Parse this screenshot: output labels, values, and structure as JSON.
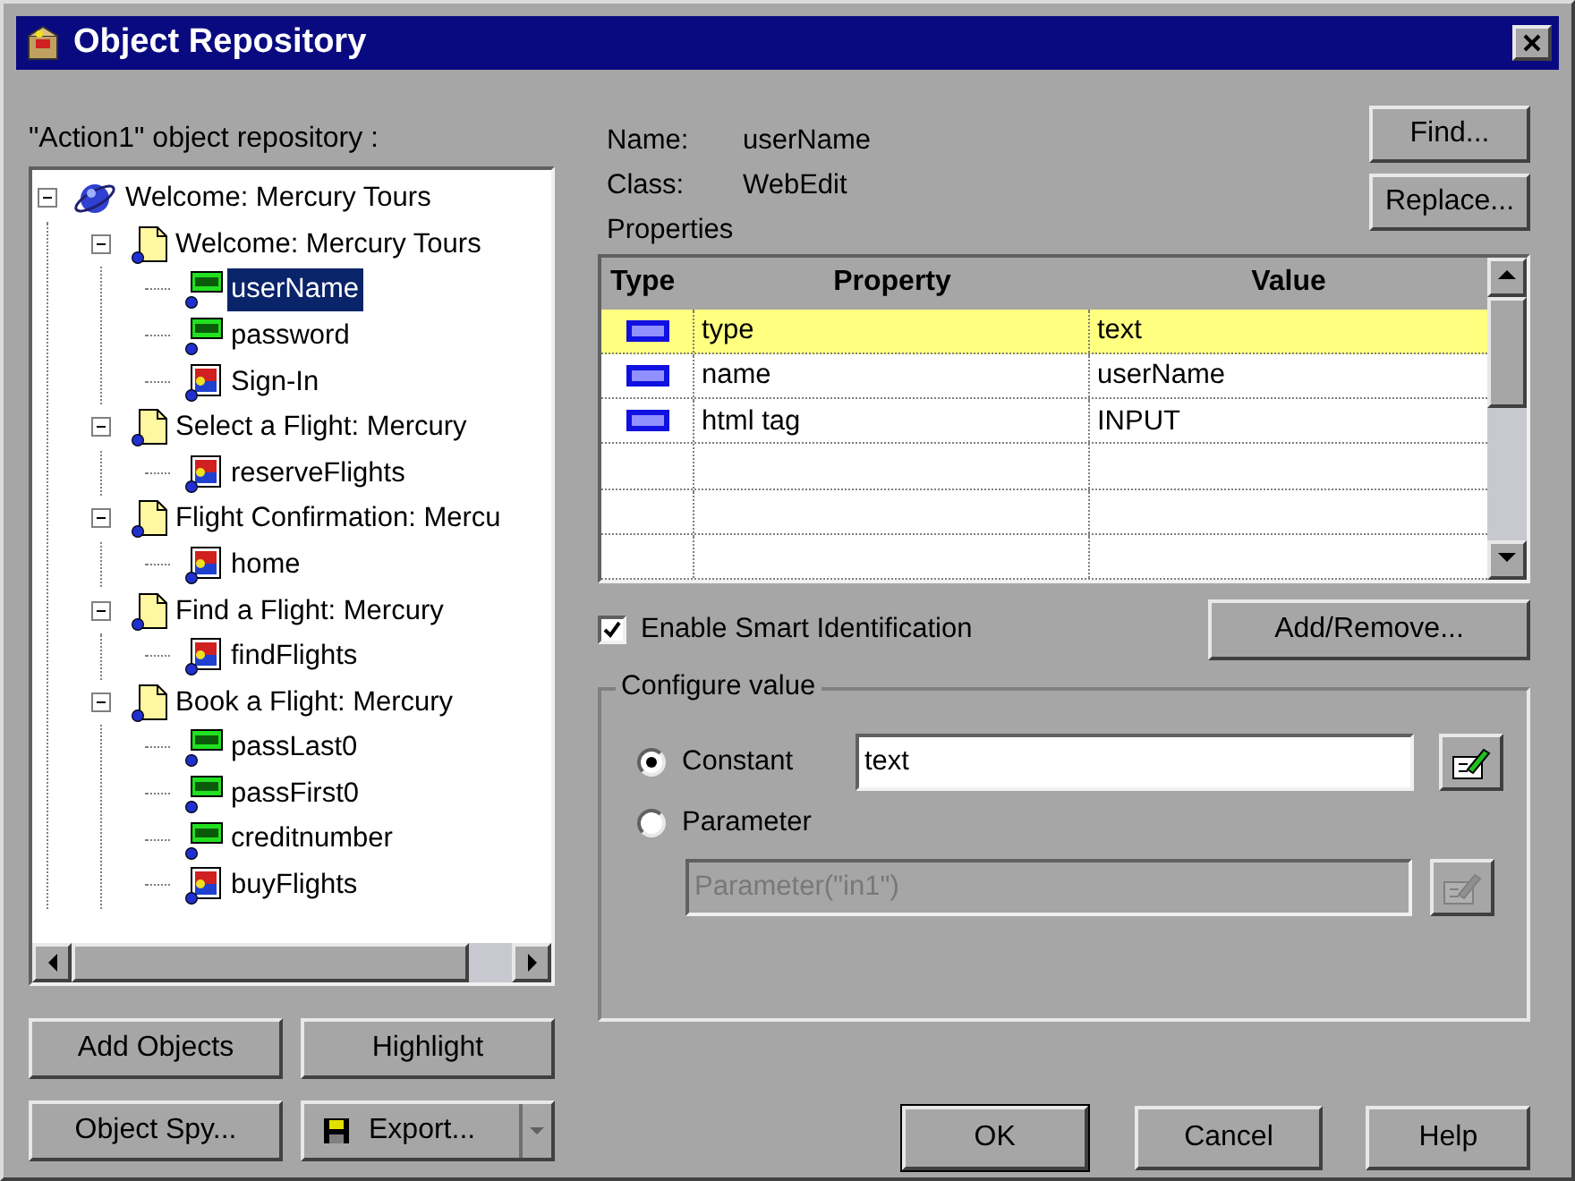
{
  "window": {
    "title": "Object Repository"
  },
  "repository_label": "\"Action1\" object repository :",
  "tree": [
    {
      "label": "Welcome: Mercury Tours",
      "kind": "browser",
      "expanded": true,
      "selected": false,
      "children": [
        {
          "label": "Welcome: Mercury Tours",
          "kind": "page",
          "expanded": true,
          "selected": false,
          "children": [
            {
              "label": "userName",
              "kind": "edit",
              "selected": true
            },
            {
              "label": "password",
              "kind": "edit",
              "selected": false
            },
            {
              "label": "Sign-In",
              "kind": "image",
              "selected": false
            }
          ]
        },
        {
          "label": "Select a Flight: Mercury",
          "kind": "page",
          "expanded": true,
          "selected": false,
          "children": [
            {
              "label": "reserveFlights",
              "kind": "image",
              "selected": false
            }
          ]
        },
        {
          "label": "Flight Confirmation: Mercu",
          "kind": "page",
          "expanded": true,
          "selected": false,
          "children": [
            {
              "label": "home",
              "kind": "image",
              "selected": false
            }
          ]
        },
        {
          "label": "Find a Flight: Mercury",
          "kind": "page",
          "expanded": true,
          "selected": false,
          "children": [
            {
              "label": "findFlights",
              "kind": "image",
              "selected": false
            }
          ]
        },
        {
          "label": "Book a Flight: Mercury",
          "kind": "page",
          "expanded": true,
          "selected": false,
          "children": [
            {
              "label": "passLast0",
              "kind": "edit",
              "selected": false
            },
            {
              "label": "passFirst0",
              "kind": "edit",
              "selected": false
            },
            {
              "label": "creditnumber",
              "kind": "edit",
              "selected": false
            },
            {
              "label": "buyFlights",
              "kind": "image",
              "selected": false
            }
          ]
        }
      ]
    }
  ],
  "details": {
    "name_label": "Name:",
    "name_value": "userName",
    "class_label": "Class:",
    "class_value": "WebEdit",
    "properties_label": "Properties"
  },
  "side_buttons": [
    "Find...",
    "Replace..."
  ],
  "table": {
    "columns": [
      "Type",
      "Property",
      "Value"
    ],
    "rows": [
      {
        "property": "type",
        "value": "text",
        "selected": true
      },
      {
        "property": "name",
        "value": "userName",
        "selected": false
      },
      {
        "property": "html tag",
        "value": "INPUT",
        "selected": false
      }
    ]
  },
  "smart_identification": {
    "label": "Enable Smart Identification",
    "checked": true
  },
  "add_remove_button": "Add/Remove...",
  "configure_value": {
    "legend": "Configure value",
    "options": [
      {
        "label": "Constant",
        "selected": true
      },
      {
        "label": "Parameter",
        "selected": false
      }
    ],
    "constant_value": "text",
    "parameter_value": "Parameter(\"in1\")",
    "parameter_disabled": true
  },
  "left_buttons": [
    {
      "label": "Add Objects",
      "kind": "plain"
    },
    {
      "label": "Highlight",
      "kind": "plain"
    },
    {
      "label": "Object Spy...",
      "kind": "plain"
    },
    {
      "label": "Export...",
      "kind": "split"
    }
  ],
  "dialog_buttons": [
    {
      "label": "OK",
      "default": true
    },
    {
      "label": "Cancel",
      "default": false
    },
    {
      "label": "Help",
      "default": false
    }
  ]
}
